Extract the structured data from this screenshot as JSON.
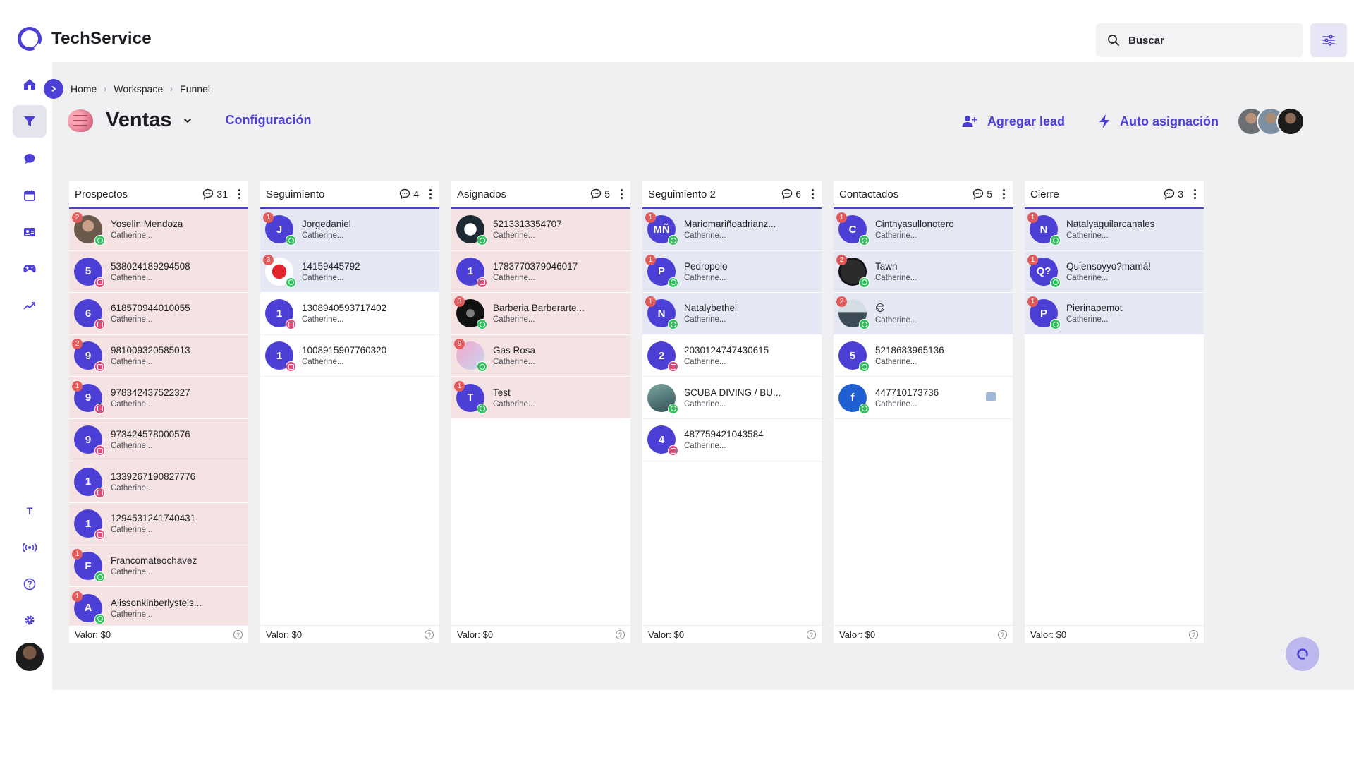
{
  "app": {
    "name": "TechService"
  },
  "search": {
    "placeholder": "Buscar"
  },
  "breadcrumb": {
    "items": [
      "Home",
      "Workspace",
      "Funnel"
    ]
  },
  "page": {
    "title": "Ventas",
    "config_label": "Configuración",
    "add_lead_label": "Agregar lead",
    "auto_assign_label": "Auto asignación"
  },
  "sidebar": {
    "text_item": "T"
  },
  "colors": {
    "accent": "#4b3fd6",
    "pink_card": "#f5e3e4",
    "blue_card": "#e6e7f4",
    "badge": "#e25a5a",
    "whatsapp": "#2fc35b",
    "instagram": "#e2497a"
  },
  "columns": [
    {
      "title": "Prospectos",
      "count": "31",
      "footer": "Valor:  $0",
      "cards": [
        {
          "name": "Yoselin Mendoza",
          "agent": "Catherine...",
          "initial": "",
          "badge": "2",
          "channel": "wa",
          "bg": "pink",
          "img": "yoselin"
        },
        {
          "name": "538024189294508",
          "agent": "Catherine...",
          "initial": "5",
          "badge": "",
          "channel": "ig",
          "bg": "pink"
        },
        {
          "name": "618570944010055",
          "agent": "Catherine...",
          "initial": "6",
          "badge": "",
          "channel": "ig",
          "bg": "pink"
        },
        {
          "name": "981009320585013",
          "agent": "Catherine...",
          "initial": "9",
          "badge": "2",
          "channel": "ig",
          "bg": "pink"
        },
        {
          "name": "978342437522327",
          "agent": "Catherine...",
          "initial": "9",
          "badge": "1",
          "channel": "ig",
          "bg": "pink"
        },
        {
          "name": "973424578000576",
          "agent": "Catherine...",
          "initial": "9",
          "badge": "",
          "channel": "ig",
          "bg": "pink"
        },
        {
          "name": "1339267190827776",
          "agent": "Catherine...",
          "initial": "1",
          "badge": "",
          "channel": "ig",
          "bg": "pink"
        },
        {
          "name": "1294531241740431",
          "agent": "Catherine...",
          "initial": "1",
          "badge": "",
          "channel": "ig",
          "bg": "pink"
        },
        {
          "name": "Francomateochavez",
          "agent": "Catherine...",
          "initial": "F",
          "badge": "1",
          "channel": "wa",
          "bg": "pink"
        },
        {
          "name": "Alissonkinberlysteis...",
          "agent": "Catherine...",
          "initial": "A",
          "badge": "1",
          "channel": "wa",
          "bg": "pink"
        }
      ]
    },
    {
      "title": "Seguimiento",
      "count": "4",
      "footer": "Valor:  $0",
      "cards": [
        {
          "name": "Jorgedaniel",
          "agent": "Catherine...",
          "initial": "J",
          "badge": "1",
          "channel": "wa",
          "bg": "blue"
        },
        {
          "name": "14159445792",
          "agent": "Catherine...",
          "initial": "",
          "badge": "3",
          "channel": "wa",
          "bg": "blue",
          "img": "14159"
        },
        {
          "name": "1308940593717402",
          "agent": "Catherine...",
          "initial": "1",
          "badge": "",
          "channel": "ig",
          "bg": "white"
        },
        {
          "name": "1008915907760320",
          "agent": "Catherine...",
          "initial": "1",
          "badge": "",
          "channel": "ig",
          "bg": "white"
        }
      ]
    },
    {
      "title": "Asignados",
      "count": "5",
      "footer": "Valor:  $0",
      "cards": [
        {
          "name": "5213313354707",
          "agent": "Catherine...",
          "initial": "",
          "badge": "",
          "channel": "wa",
          "bg": "pink",
          "img": "52133"
        },
        {
          "name": "1783770379046017",
          "agent": "Catherine...",
          "initial": "1",
          "badge": "",
          "channel": "ig",
          "bg": "pink"
        },
        {
          "name": "Barberia Barberarte...",
          "agent": "Catherine...",
          "initial": "",
          "badge": "3",
          "channel": "wa",
          "bg": "pink",
          "img": "barberia"
        },
        {
          "name": "Gas Rosa",
          "agent": "Catherine...",
          "initial": "",
          "badge": "9",
          "channel": "wa",
          "bg": "pink",
          "img": "gas"
        },
        {
          "name": "Test",
          "agent": "Catherine...",
          "initial": "T",
          "badge": "1",
          "channel": "wa",
          "bg": "pink"
        }
      ]
    },
    {
      "title": "Seguimiento 2",
      "count": "6",
      "footer": "Valor:  $0",
      "cards": [
        {
          "name": "Mariomariñoadrianz...",
          "agent": "Catherine...",
          "initial": "MÑ",
          "badge": "1",
          "channel": "wa",
          "bg": "blue"
        },
        {
          "name": "Pedropolo",
          "agent": "Catherine...",
          "initial": "P",
          "badge": "1",
          "channel": "wa",
          "bg": "blue"
        },
        {
          "name": "Natalybethel",
          "agent": "Catherine...",
          "initial": "N",
          "badge": "1",
          "channel": "wa",
          "bg": "blue"
        },
        {
          "name": "2030124747430615",
          "agent": "Catherine...",
          "initial": "2",
          "badge": "",
          "channel": "ig",
          "bg": "white"
        },
        {
          "name": "SCUBA DIVING / BU...",
          "agent": "Catherine...",
          "initial": "",
          "badge": "",
          "channel": "wa",
          "bg": "white",
          "img": "scuba"
        },
        {
          "name": "487759421043584",
          "agent": "Catherine...",
          "initial": "4",
          "badge": "",
          "channel": "ig",
          "bg": "white"
        }
      ]
    },
    {
      "title": "Contactados",
      "count": "5",
      "footer": "Valor:  $0",
      "cards": [
        {
          "name": "Cinthyasullonotero",
          "agent": "Catherine...",
          "initial": "C",
          "badge": "1",
          "channel": "wa",
          "bg": "blue"
        },
        {
          "name": "Tawn",
          "agent": "Catherine...",
          "initial": "",
          "badge": "2",
          "channel": "wa",
          "bg": "blue",
          "img": "tawn"
        },
        {
          "name": "😄",
          "agent": "Catherine...",
          "initial": "",
          "badge": "2",
          "channel": "wa",
          "bg": "blue",
          "img": "emoji"
        },
        {
          "name": "5218683965136",
          "agent": "Catherine...",
          "initial": "5",
          "badge": "",
          "channel": "wa",
          "bg": "white"
        },
        {
          "name": "447710173736",
          "agent": "Catherine...",
          "initial": "f",
          "badge": "",
          "channel": "wa",
          "bg": "white",
          "img": "fb",
          "extra": true
        }
      ]
    },
    {
      "title": "Cierre",
      "count": "3",
      "footer": "Valor:  $0",
      "cards": [
        {
          "name": "Natalyaguilarcanales",
          "agent": "Catherine...",
          "initial": "N",
          "badge": "1",
          "channel": "wa",
          "bg": "blue"
        },
        {
          "name": "Quiensoyyo?mamá!",
          "agent": "Catherine...",
          "initial": "Q?",
          "badge": "1",
          "channel": "wa",
          "bg": "blue"
        },
        {
          "name": "Pierinapemot",
          "agent": "Catherine...",
          "initial": "P",
          "badge": "1",
          "channel": "wa",
          "bg": "blue"
        }
      ]
    }
  ]
}
